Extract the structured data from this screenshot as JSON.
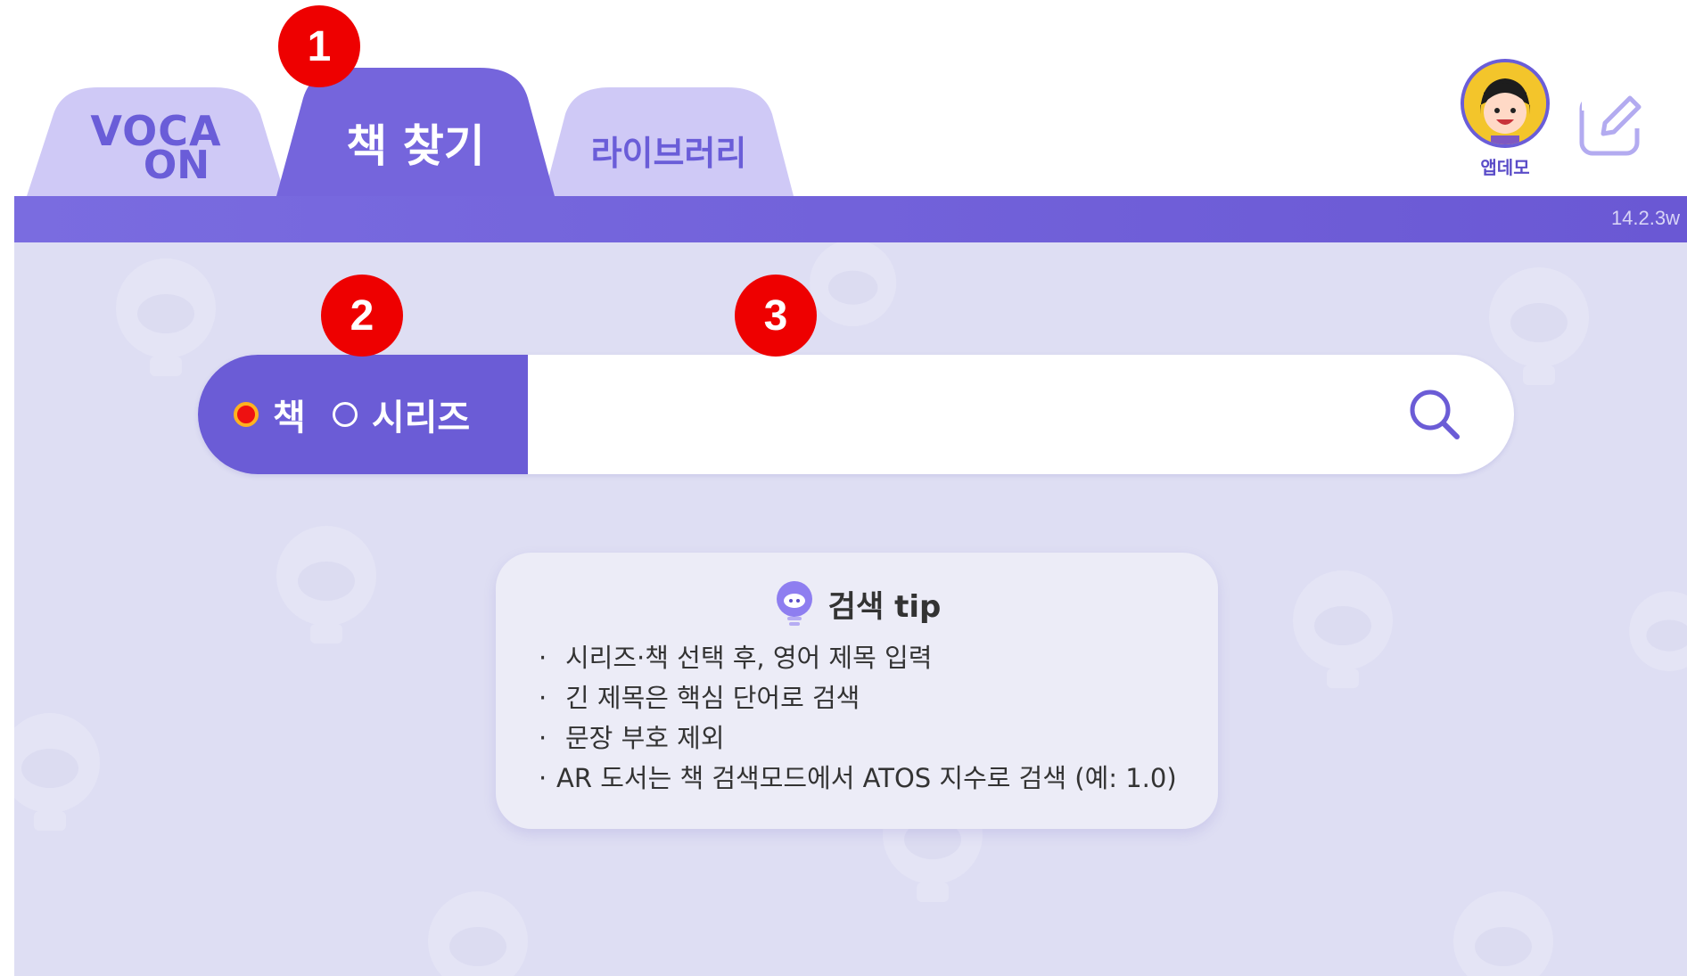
{
  "tabs": {
    "voca_line1": "VOCA",
    "voca_line2": "ON",
    "find_book": "책 찾기",
    "library": "라이브러리"
  },
  "version": "14.2.3w",
  "profile": {
    "name": "앱데모"
  },
  "search": {
    "mode_book": "책",
    "mode_series": "시리즈",
    "selected_mode": "책",
    "value": "",
    "placeholder": ""
  },
  "tip": {
    "title": "검색 tip",
    "items": [
      "시리즈·책 선택 후, 영어 제목 입력",
      "긴 제목은 핵심 단어로 검색",
      "문장 부호 제외",
      "AR 도서는 책 검색모드에서 ATOS 지수로 검색 (예: 1.0)"
    ],
    "bullet": "·"
  },
  "markers": [
    "1",
    "2",
    "3"
  ],
  "colors": {
    "accent": "#6b5cd6",
    "tab_inactive": "#cfc9f6",
    "background": "#dedef3",
    "marker": "#ee0000"
  }
}
